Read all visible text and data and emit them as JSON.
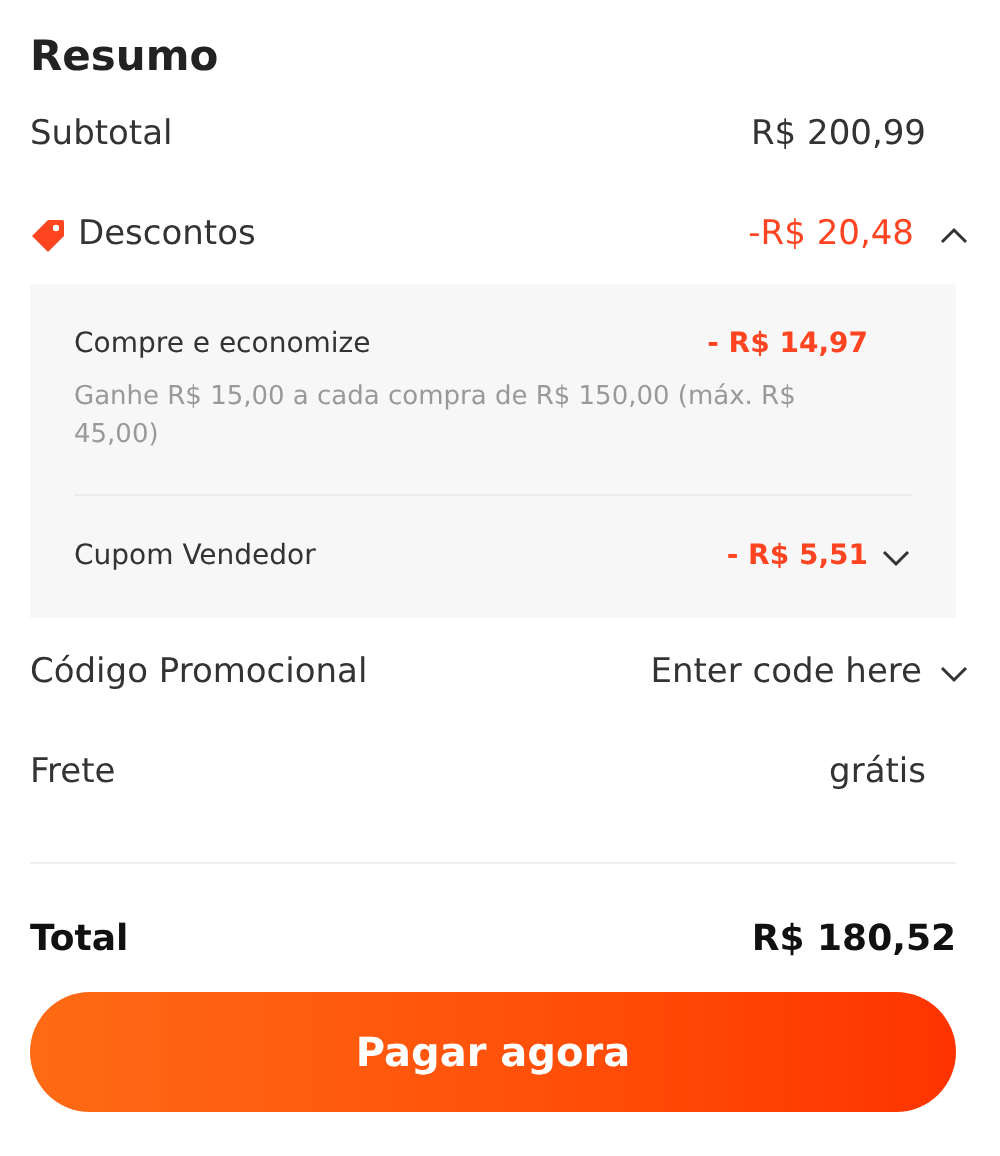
{
  "title": "Resumo",
  "subtotal": {
    "label": "Subtotal",
    "value": "R$ 200,99"
  },
  "discounts": {
    "label": "Descontos",
    "value": "-R$ 20,48",
    "expanded": true,
    "items": [
      {
        "label": "Compre e economize",
        "value": "- R$ 14,97",
        "description": "Ganhe R$ 15,00 a cada compra de R$ 150,00 (máx. R$ 45,00)"
      },
      {
        "label": "Cupom Vendedor",
        "value": "- R$ 5,51",
        "expanded": false
      }
    ]
  },
  "promo_code": {
    "label": "Código Promocional",
    "placeholder": "Enter code here"
  },
  "shipping": {
    "label": "Frete",
    "value": "grátis"
  },
  "total": {
    "label": "Total",
    "value": "R$ 180,52"
  },
  "pay_button": "Pagar agora"
}
